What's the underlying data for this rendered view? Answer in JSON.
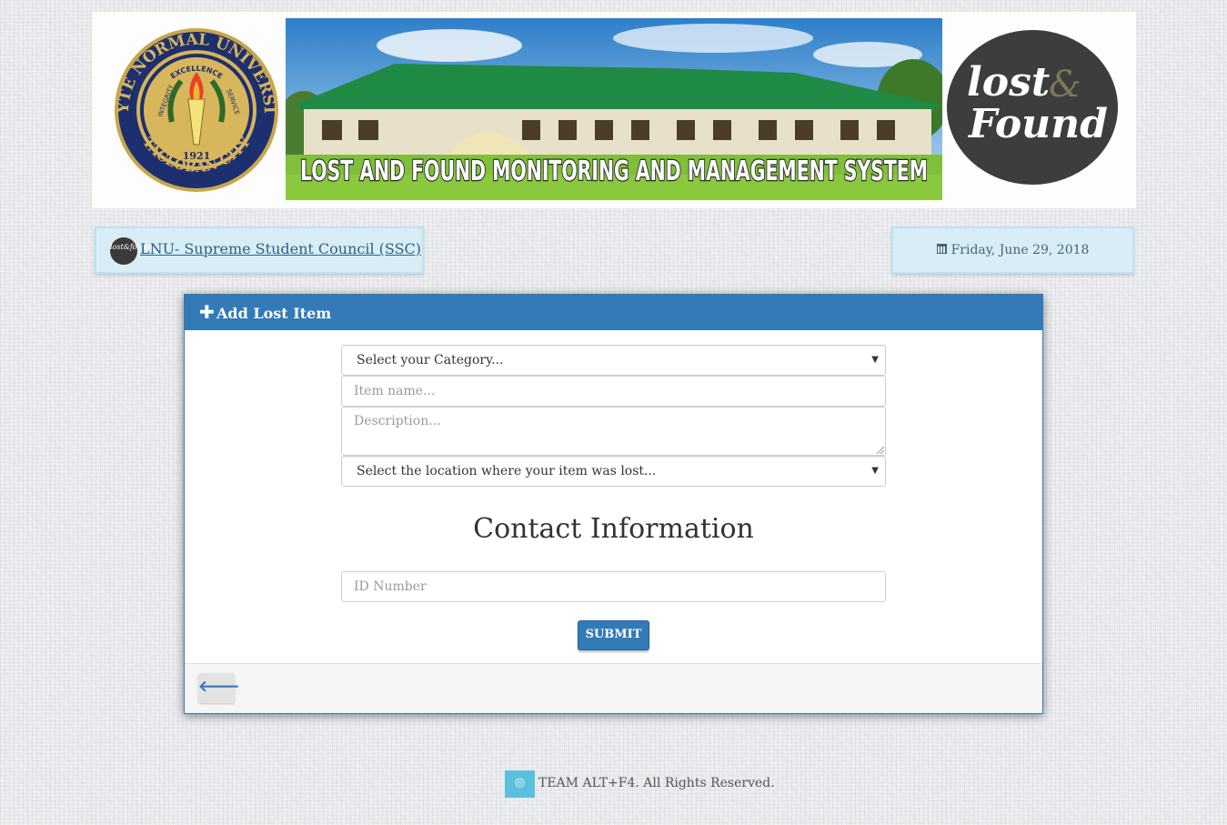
{
  "banner": {
    "seal": {
      "ring_text_top": "LEYTE NORMAL UNIVERSITY",
      "ring_text_bottom": "TACLOBAN CITY",
      "motto_top": "EXCELLENCE",
      "motto_left": "INTEGRITY",
      "motto_right": "SERVICE",
      "year": "1921"
    },
    "hero_title": "LOST AND FOUND MONITORING AND MANAGEMENT SYSTEM",
    "logo_lost": "lost",
    "logo_amp": "&",
    "logo_found": "Found"
  },
  "ssc": {
    "avatar_text": "lost&found",
    "link_label": "LNU- Supreme Student Council (SSC)"
  },
  "date": {
    "icon": "calendar-icon",
    "text": "Friday, June 29, 2018"
  },
  "panel": {
    "title": "Add Lost Item",
    "title_icon": "plus-icon",
    "category_selected": "Select your Category...",
    "item_name_placeholder": "Item name...",
    "description_placeholder": "Description...",
    "location_selected": "Select the location where your item was lost...",
    "contact_heading": "Contact Information",
    "id_placeholder": "ID Number",
    "submit_label": "SUBMIT",
    "back_icon": "arrow-left-icon"
  },
  "footer": {
    "icon": "copyright-icon",
    "text": "TEAM ALT+F4. All Rights Reserved."
  },
  "colors": {
    "primary": "#337ab7",
    "info_bg": "#d9edf7",
    "footer_icon_bg": "#5bc0de",
    "logo_bg": "#3d3d3d",
    "seal_gold": "#c9a64a",
    "seal_navy": "#1d2f6f"
  }
}
